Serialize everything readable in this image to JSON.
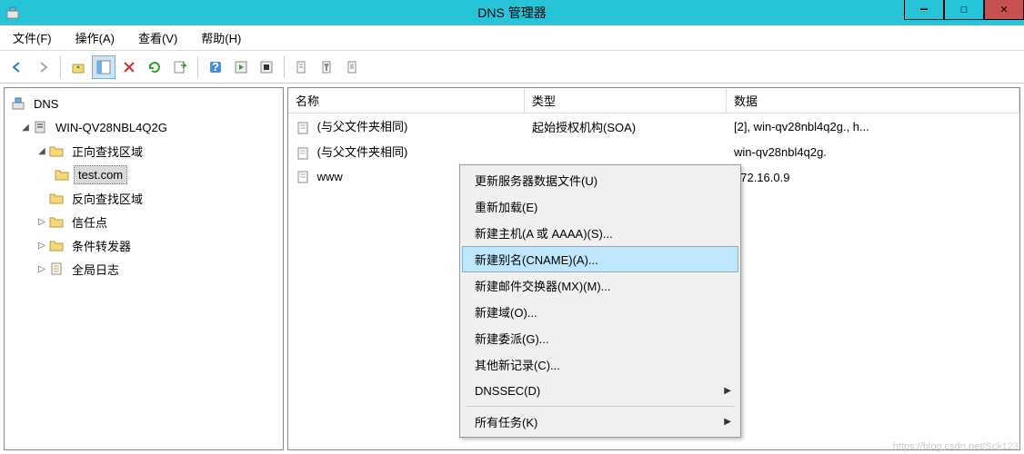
{
  "window": {
    "title": "DNS 管理器"
  },
  "menu": {
    "file": "文件(F)",
    "action": "操作(A)",
    "view": "查看(V)",
    "help": "帮助(H)"
  },
  "tree": {
    "root": "DNS",
    "server": "WIN-QV28NBL4Q2G",
    "fwd_zone": "正向查找区域",
    "domain": "test.com",
    "rev_zone": "反向查找区域",
    "trust": "信任点",
    "cond_fwd": "条件转发器",
    "global_log": "全局日志"
  },
  "cols": {
    "name": "名称",
    "type": "类型",
    "data": "数据"
  },
  "rows": [
    {
      "name": "(与父文件夹相同)",
      "type": "起始授权机构(SOA)",
      "data": "[2], win-qv28nbl4q2g., h..."
    },
    {
      "name": "(与父文件夹相同)",
      "type": "",
      "data": "win-qv28nbl4q2g."
    },
    {
      "name": "www",
      "type": "",
      "data": "172.16.0.9"
    }
  ],
  "ctx": {
    "update": "更新服务器数据文件(U)",
    "reload": "重新加载(E)",
    "new_host": "新建主机(A 或 AAAA)(S)...",
    "new_cname": "新建别名(CNAME)(A)...",
    "new_mx": "新建邮件交换器(MX)(M)...",
    "new_domain": "新建域(O)...",
    "new_delegation": "新建委派(G)...",
    "other_records": "其他新记录(C)...",
    "dnssec": "DNSSEC(D)",
    "all_tasks": "所有任务(K)"
  },
  "watermark": "https://blog.csdn.net/Sck123"
}
